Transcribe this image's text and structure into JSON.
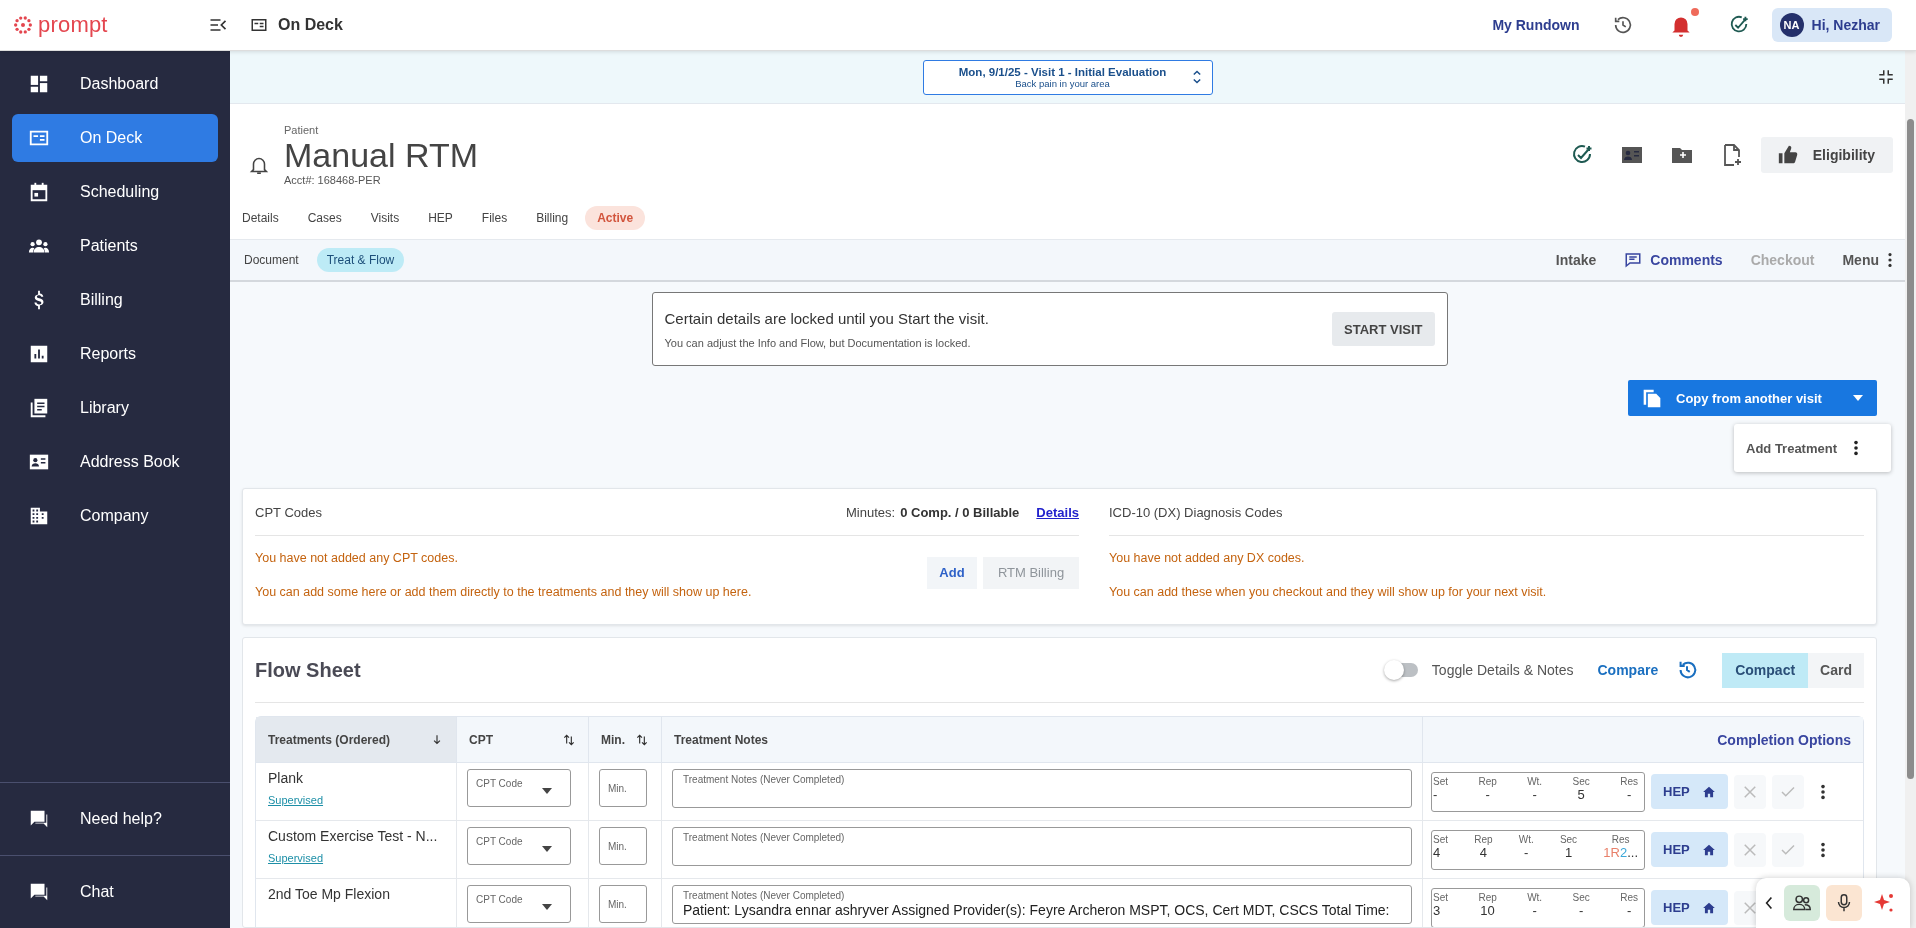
{
  "app": {
    "logo": "prompt",
    "page_title": "On Deck"
  },
  "top_bar": {
    "rundown": "My Rundown",
    "alert": true,
    "user": {
      "initials": "NA",
      "greeting": "Hi, Nezhar"
    }
  },
  "sidebar": {
    "items": [
      {
        "label": "Dashboard",
        "selected": false
      },
      {
        "label": "On Deck",
        "selected": true
      },
      {
        "label": "Scheduling",
        "selected": false
      },
      {
        "label": "Patients",
        "selected": false
      },
      {
        "label": "Billing",
        "selected": false
      },
      {
        "label": "Reports",
        "selected": false
      },
      {
        "label": "Library",
        "selected": false
      },
      {
        "label": "Address Book",
        "selected": false
      },
      {
        "label": "Company",
        "selected": false
      }
    ],
    "footer": [
      {
        "label": "Need help?"
      },
      {
        "label": "Chat"
      }
    ]
  },
  "visit_selector": {
    "title": "Mon, 9/1/25 - Visit 1 - Initial Evaluation",
    "subtitle": "Back pain in your area"
  },
  "patient": {
    "label": "Patient",
    "name": "Manual RTM",
    "account": "Acct#: 168468-PER",
    "eligibility": "Eligibility",
    "tabs": [
      {
        "label": "Details",
        "kind": "tab"
      },
      {
        "label": "Cases",
        "kind": "tab"
      },
      {
        "label": "Visits",
        "kind": "tab"
      },
      {
        "label": "HEP",
        "kind": "tab"
      },
      {
        "label": "Files",
        "kind": "tab"
      },
      {
        "label": "Billing",
        "kind": "tab"
      },
      {
        "label": "Active",
        "kind": "status"
      }
    ]
  },
  "document_bar": {
    "label": "Document",
    "tabs": [
      {
        "label": "Treat & Flow",
        "selected": true
      }
    ],
    "actions": [
      {
        "label": "Intake",
        "kind": "link",
        "disabled": false
      },
      {
        "label": "Comments",
        "kind": "comments",
        "disabled": false
      },
      {
        "label": "Checkout",
        "kind": "link",
        "disabled": true
      },
      {
        "label": "Menu",
        "kind": "menu",
        "disabled": false
      }
    ]
  },
  "lock_notice": {
    "title": "Certain details are locked until you Start the visit.",
    "message": "You can adjust the Info and Flow, but Documentation is locked.",
    "button": "START VISIT"
  },
  "copy_button": "Copy from another visit",
  "add_treatment": "Add Treatment",
  "cpt": {
    "title": "CPT Codes",
    "minutes_label": "Minutes:",
    "minutes_value": "0 Comp. / 0 Billable",
    "details": "Details",
    "empty": "You have not added any CPT codes.",
    "hint": "You can add some here or add them directly to the treatments and they will show up here.",
    "add": "Add",
    "rtm_billing": {
      "label": "RTM Billing",
      "disabled": true
    }
  },
  "dx": {
    "title": "ICD-10 (DX) Diagnosis Codes",
    "empty": "You have not added any DX codes.",
    "hint": "You can add these when you checkout and they will show up for your next visit."
  },
  "flow_sheet": {
    "title": "Flow Sheet",
    "toggle": {
      "label": "Toggle Details & Notes",
      "on": false
    },
    "compare": "Compare",
    "views": [
      {
        "label": "Compact",
        "selected": true
      },
      {
        "label": "Card",
        "selected": false
      }
    ],
    "columns": [
      "Treatments (Ordered)",
      "CPT",
      "Min.",
      "Treatment Notes",
      "Completion Options"
    ],
    "rows": [
      {
        "name": "Plank",
        "mode": "Supervised",
        "cpt_placeholder": "CPT Code",
        "min_placeholder": "Min.",
        "notes_placeholder": "Treatment Notes (Never Completed)",
        "hep": "HEP",
        "metrics": [
          {
            "label": "Set",
            "value": "-"
          },
          {
            "label": "Rep",
            "value": "-"
          },
          {
            "label": "Wt.",
            "value": "-"
          },
          {
            "label": "Sec",
            "value": "5"
          },
          {
            "label": "Res",
            "value": "-"
          }
        ]
      },
      {
        "name": "Custom Exercise Test - N...",
        "mode": "Supervised",
        "cpt_placeholder": "CPT Code",
        "min_placeholder": "Min.",
        "notes_placeholder": "Treatment Notes (Never Completed)",
        "hep": "HEP",
        "metrics": [
          {
            "label": "Set",
            "value": "4"
          },
          {
            "label": "Rep",
            "value": "4"
          },
          {
            "label": "Wt.",
            "value": "-"
          },
          {
            "label": "Sec",
            "value": "1"
          },
          {
            "label": "Res",
            "parts": [
              {
                "text": "1R",
                "color": "#e8806a"
              },
              {
                "text": "2",
                "color": "#3aa7d8"
              },
              {
                "text": "..."
              }
            ]
          }
        ]
      },
      {
        "name": "2nd Toe Mp Flexion",
        "covered": true,
        "cpt_placeholder": "CPT Code",
        "min_placeholder": "Min.",
        "notes_placeholder": "Treatment Notes (Never Completed)",
        "notes": "Patient: Lysandra ennar ashryver Assigned Provider(s): Feyre Archeron MSPT, OCS, Cert MDT, CSCS Total Time:",
        "hep": "HEP",
        "metrics": [
          {
            "label": "Set",
            "value": "3"
          },
          {
            "label": "Rep",
            "value": "10"
          },
          {
            "label": "Wt.",
            "value": "-"
          },
          {
            "label": "Sec",
            "value": "-"
          },
          {
            "label": "Res",
            "value": "-"
          }
        ]
      }
    ]
  }
}
